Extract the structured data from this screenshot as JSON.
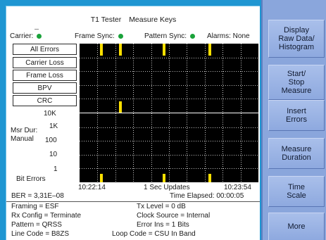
{
  "header": {
    "title": "T1 Tester",
    "subtitle": "Measure Keys"
  },
  "status": {
    "carrier_label": "Carrier:",
    "frame_sync_label": "Frame Sync:",
    "pattern_sync_label": "Pattern Sync:",
    "alarms_label": "Alarms: None",
    "ok_color": "#1aa23a"
  },
  "error_buttons": [
    {
      "label": "All Errors"
    },
    {
      "label": "Carrier Loss"
    },
    {
      "label": "Frame Loss"
    },
    {
      "label": "BPV"
    },
    {
      "label": "CRC"
    }
  ],
  "bit_errors_panel": {
    "y_ticks": [
      "10K",
      "1K",
      "100",
      "10",
      "1"
    ],
    "msr_dur_label": "Msr Dur:",
    "msr_dur_value": "Manual",
    "axis_title": "Bit Errors"
  },
  "time_axis": {
    "start": "10:22:14",
    "middle": "1 Sec Updates",
    "end": "10:23:54"
  },
  "summary": {
    "ber": "BER = 3,31E–08",
    "time_elapsed": "Time Elapsed: 00:00:05"
  },
  "config": {
    "framing": "Framing = ESF",
    "rx_config": "Rx Config = Terminate",
    "pattern": "Pattern = QRSS",
    "line_code": "Line Code = B8ZS",
    "tx_level": "Tx Level = 0 dB",
    "clock_source": "Clock Source = Internal",
    "error_ins": "Error Ins = 1 Bits",
    "loop_code": "Loop Code = CSU In Band"
  },
  "sidebar": {
    "buttons": [
      {
        "label": "Display\nRaw Data/\nHistogram"
      },
      {
        "label": "Start/\nStop\nMeasure"
      },
      {
        "label": "Insert\nErrors"
      },
      {
        "label": "Measure\nDuration"
      },
      {
        "label": "Time\nScale"
      },
      {
        "label": "More"
      }
    ]
  },
  "colors": {
    "frame_blue": "#1f96d2",
    "sidebar_blue": "#8aa6dc",
    "event_marker": "#ffe000",
    "chart_bg": "#000000"
  }
}
